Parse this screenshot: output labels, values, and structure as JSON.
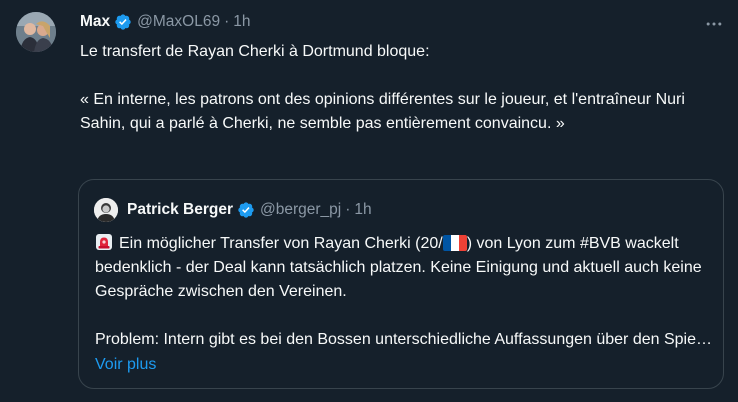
{
  "tweet": {
    "author_name": "Max",
    "author_handle": "@MaxOL69",
    "separator": "·",
    "time": "1h",
    "paragraph_1": "Le transfert de Rayan Cherki à Dortmund bloque:",
    "paragraph_2": "« En interne, les patrons ont des opinions différentes sur le joueur, et l'entraîneur Nuri Sahin, qui a parlé à Cherki, ne semble pas entièrement convaincu. »",
    "verified_icon": "verified-badge-icon",
    "more_icon": "more-horizontal-icon"
  },
  "quote": {
    "author_name": "Patrick Berger",
    "author_handle": "@berger_pj",
    "separator": "·",
    "time": "1h",
    "text_part1": "Ein möglicher Transfer von Rayan Cherki (20/",
    "text_part2": ") von Lyon zum #BVB wackelt bedenklich - der Deal kann tatsächlich platzen. Keine Einigung und aktuell auch keine Gespräche zwischen den Vereinen.",
    "paragraph_2": "Problem: Intern gibt es bei den Bossen unterschiedliche Auffassungen über den Spieler, auch Trainer Nuri Sahin, der mit Cherki gesprochen hat, soll noch nicht restlos überzeugt sein.",
    "siren_icon": "siren-emoji-icon",
    "flag_icon": "france-flag-icon",
    "show_more": "Voir plus"
  },
  "colors": {
    "background": "#15202b",
    "text": "#f7f9f9",
    "muted": "#8b98a5",
    "border": "#38444d",
    "link": "#1d9bf0"
  }
}
